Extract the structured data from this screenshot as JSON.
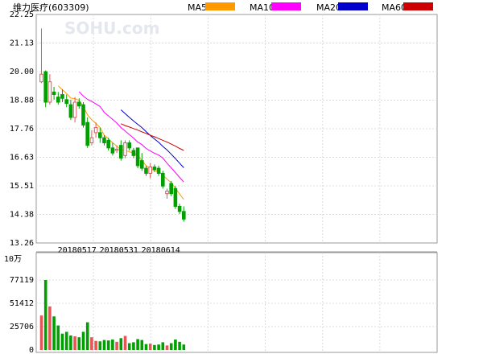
{
  "header": {
    "title": "维力医疗(603309)",
    "watermark": "SOHU.com"
  },
  "price_chart": {
    "ylim": [
      13.26,
      22.25
    ],
    "yticks": [
      "22.25",
      "21.13",
      "20.00",
      "18.88",
      "17.76",
      "16.63",
      "15.51",
      "14.38",
      "13.26"
    ],
    "date_labels": [
      {
        "label": "20180517",
        "day_index": 8.5
      },
      {
        "label": "20180531",
        "day_index": 18.5
      },
      {
        "label": "20180614",
        "day_index": 28.5
      }
    ],
    "legend": [
      {
        "name": "MA5",
        "color": "#ff9900"
      },
      {
        "name": "MA10",
        "color": "#ff00ff"
      },
      {
        "name": "MA20",
        "color": "#0000cc"
      },
      {
        "name": "MA60",
        "color": "#cc0000"
      }
    ]
  },
  "volume_chart": {
    "unit": "10万",
    "ylim": [
      0,
      77119
    ],
    "yticks": [
      "77119",
      "51412",
      "25706",
      "0"
    ]
  },
  "chart_data": {
    "type": "candlestick",
    "up_color": "#e65656",
    "down_color": "#00a000",
    "candles": [
      {
        "o": 19.6,
        "h": 21.7,
        "l": 19.55,
        "c": 19.9,
        "v": 38000
      },
      {
        "o": 20.0,
        "h": 20.05,
        "l": 18.6,
        "c": 18.8,
        "v": 77119
      },
      {
        "o": 18.8,
        "h": 19.9,
        "l": 18.7,
        "c": 19.6,
        "v": 48000
      },
      {
        "o": 19.2,
        "h": 19.4,
        "l": 18.9,
        "c": 19.1,
        "v": 37000
      },
      {
        "o": 19.0,
        "h": 19.2,
        "l": 18.7,
        "c": 18.8,
        "v": 27000
      },
      {
        "o": 19.1,
        "h": 19.3,
        "l": 18.8,
        "c": 18.95,
        "v": 18000
      },
      {
        "o": 18.9,
        "h": 19.1,
        "l": 18.6,
        "c": 18.75,
        "v": 20000
      },
      {
        "o": 18.7,
        "h": 18.9,
        "l": 18.1,
        "c": 18.2,
        "v": 16000
      },
      {
        "o": 18.2,
        "h": 19.0,
        "l": 18.0,
        "c": 18.8,
        "v": 15000
      },
      {
        "o": 18.8,
        "h": 18.95,
        "l": 18.55,
        "c": 18.65,
        "v": 14000
      },
      {
        "o": 18.7,
        "h": 18.8,
        "l": 17.8,
        "c": 17.9,
        "v": 20000
      },
      {
        "o": 18.0,
        "h": 18.2,
        "l": 17.0,
        "c": 17.1,
        "v": 30500
      },
      {
        "o": 17.2,
        "h": 17.7,
        "l": 17.1,
        "c": 17.4,
        "v": 14000
      },
      {
        "o": 17.6,
        "h": 18.0,
        "l": 17.4,
        "c": 17.8,
        "v": 10000
      },
      {
        "o": 17.6,
        "h": 17.8,
        "l": 17.2,
        "c": 17.4,
        "v": 9500
      },
      {
        "o": 17.4,
        "h": 17.5,
        "l": 17.1,
        "c": 17.2,
        "v": 11000
      },
      {
        "o": 17.3,
        "h": 17.4,
        "l": 16.9,
        "c": 17.0,
        "v": 10500
      },
      {
        "o": 17.0,
        "h": 17.2,
        "l": 16.7,
        "c": 16.8,
        "v": 11500
      },
      {
        "o": 16.9,
        "h": 17.1,
        "l": 16.8,
        "c": 16.95,
        "v": 9000
      },
      {
        "o": 17.1,
        "h": 17.3,
        "l": 16.5,
        "c": 16.6,
        "v": 13000
      },
      {
        "o": 16.7,
        "h": 17.3,
        "l": 16.6,
        "c": 17.2,
        "v": 15500
      },
      {
        "o": 17.2,
        "h": 17.3,
        "l": 16.9,
        "c": 17.0,
        "v": 7500
      },
      {
        "o": 16.9,
        "h": 17.0,
        "l": 16.6,
        "c": 16.7,
        "v": 8500
      },
      {
        "o": 17.0,
        "h": 17.0,
        "l": 16.2,
        "c": 16.3,
        "v": 12000
      },
      {
        "o": 16.5,
        "h": 16.8,
        "l": 16.1,
        "c": 16.2,
        "v": 11000
      },
      {
        "o": 16.2,
        "h": 16.3,
        "l": 15.9,
        "c": 16.0,
        "v": 6500
      },
      {
        "o": 16.0,
        "h": 16.4,
        "l": 15.8,
        "c": 16.25,
        "v": 7000
      },
      {
        "o": 16.25,
        "h": 16.35,
        "l": 16.05,
        "c": 16.15,
        "v": 5500
      },
      {
        "o": 16.2,
        "h": 16.3,
        "l": 15.9,
        "c": 16.0,
        "v": 6000
      },
      {
        "o": 16.0,
        "h": 16.1,
        "l": 15.4,
        "c": 15.5,
        "v": 8500
      },
      {
        "o": 15.2,
        "h": 15.4,
        "l": 15.0,
        "c": 15.3,
        "v": 5000
      },
      {
        "o": 15.6,
        "h": 15.7,
        "l": 15.1,
        "c": 15.2,
        "v": 7500
      },
      {
        "o": 15.4,
        "h": 15.5,
        "l": 14.6,
        "c": 14.7,
        "v": 11500
      },
      {
        "o": 14.7,
        "h": 14.8,
        "l": 14.4,
        "c": 14.5,
        "v": 9000
      },
      {
        "o": 14.5,
        "h": 14.7,
        "l": 14.1,
        "c": 14.2,
        "v": 6000
      }
    ],
    "ma5": [
      null,
      null,
      null,
      null,
      19.44,
      19.29,
      19.14,
      18.96,
      18.94,
      18.87,
      18.64,
      18.3,
      18.11,
      17.96,
      17.8,
      17.5,
      17.36,
      17.2,
      17.07,
      16.92,
      16.91,
      16.85,
      16.8,
      16.7,
      16.5,
      16.3,
      16.19,
      16.1,
      16.08,
      15.93,
      15.77,
      15.63,
      15.41,
      15.19,
      14.97
    ],
    "ma10": [
      null,
      null,
      null,
      null,
      null,
      null,
      null,
      null,
      null,
      19.21,
      19.04,
      18.91,
      18.83,
      18.73,
      18.63,
      18.4,
      18.26,
      18.12,
      17.98,
      17.8,
      17.67,
      17.52,
      17.39,
      17.23,
      17.13,
      16.98,
      16.88,
      16.79,
      16.72,
      16.6,
      16.4,
      16.22,
      16.03,
      15.84,
      15.66
    ],
    "ma20": [
      null,
      null,
      null,
      null,
      null,
      null,
      null,
      null,
      null,
      null,
      null,
      null,
      null,
      null,
      null,
      null,
      null,
      null,
      null,
      18.5,
      18.35,
      18.2,
      18.06,
      17.93,
      17.8,
      17.64,
      17.49,
      17.35,
      17.22,
      17.06,
      16.92,
      16.75,
      16.58,
      16.4,
      16.22
    ],
    "ma60": [
      null,
      null,
      null,
      null,
      null,
      null,
      null,
      null,
      null,
      null,
      null,
      null,
      null,
      null,
      null,
      null,
      null,
      null,
      null,
      17.95,
      17.88,
      17.82,
      17.76,
      17.7,
      17.63,
      17.57,
      17.5,
      17.44,
      17.37,
      17.3,
      17.23,
      17.15,
      17.07,
      16.98,
      16.9
    ]
  }
}
